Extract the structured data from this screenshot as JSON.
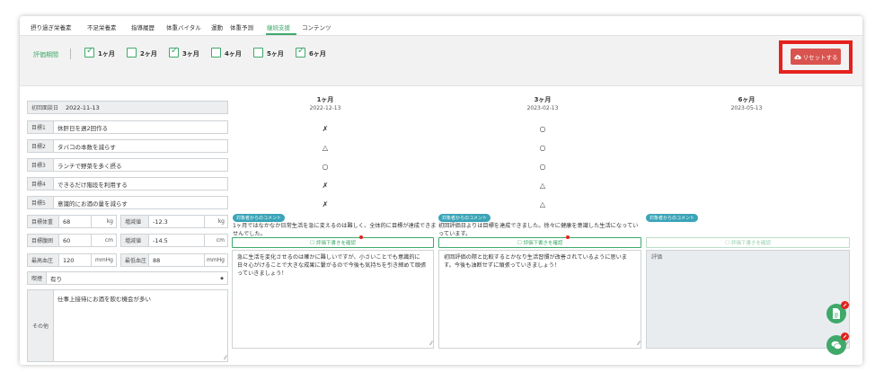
{
  "tabs": [
    {
      "label": "摂り過ぎ栄養素"
    },
    {
      "label": "不足栄養素"
    },
    {
      "label": "指導履歴"
    },
    {
      "label": "体重バイタル"
    },
    {
      "label": "運動"
    },
    {
      "label": "体重予測"
    },
    {
      "label": "継続支援"
    },
    {
      "label": "コンテンツ"
    }
  ],
  "filter": {
    "label": "評価期間",
    "options": [
      {
        "label": "1ヶ月",
        "checked": true
      },
      {
        "label": "2ヶ月",
        "checked": false
      },
      {
        "label": "3ヶ月",
        "checked": true
      },
      {
        "label": "4ヶ月",
        "checked": false
      },
      {
        "label": "5ヶ月",
        "checked": false
      },
      {
        "label": "6ヶ月",
        "checked": true
      }
    ],
    "reset_label": "リセットする"
  },
  "left": {
    "first_interview_label": "初回面談日",
    "first_interview_value": "2022-11-13",
    "goals": [
      {
        "label": "目標1",
        "value": "休肝日を週2回作る"
      },
      {
        "label": "目標2",
        "value": "タバコの本数を減らす"
      },
      {
        "label": "目標3",
        "value": "ランチで野菜を多く摂る"
      },
      {
        "label": "目標4",
        "value": "できるだけ階段を利用する"
      },
      {
        "label": "目標5",
        "value": "意識的にお酒の量を減らす"
      }
    ],
    "metrics": [
      {
        "label": "目標体重",
        "value": "68",
        "unit": "kg",
        "label2": "増減値",
        "value2": "-12.3",
        "unit2": "kg"
      },
      {
        "label": "目標腹囲",
        "value": "60",
        "unit": "cm",
        "label2": "増減値",
        "value2": "-14.5",
        "unit2": "cm"
      },
      {
        "label": "最高血圧",
        "value": "120",
        "unit": "mmHg",
        "label2": "最低血圧",
        "value2": "88",
        "unit2": "mmHg"
      }
    ],
    "smoking_label": "喫煙",
    "smoking_value": "有り",
    "other_label": "その他",
    "other_value": "仕事上接待にお酒を飲む機会が多い"
  },
  "columns": [
    {
      "month": "1ヶ月",
      "date": "2022-12-13",
      "marks": [
        "✗",
        "△",
        "○",
        "✗",
        "✗"
      ],
      "comment_tag": "対象者からのコメント",
      "comment": "1ヶ月ではなかなか日常生活を急に変えるのは難しく、全体的に目標が達成できませんでした。",
      "eval_button": "評価下書きを確認",
      "eval_text": "急に生活を変化させるのは確かに難しいですが、小さいことでも意識的に日々心がけることで大きな成果に繋がるので今後も気持ちを引き締めて頑張っていきましょう！"
    },
    {
      "month": "3ヶ月",
      "date": "2023-02-13",
      "marks": [
        "○",
        "○",
        "○",
        "△",
        "△"
      ],
      "comment_tag": "対象者からのコメント",
      "comment": "初回評価日よりは目標を達成できました。徐々に健康を意識した生活になっていっています。",
      "eval_button": "評価下書きを確認",
      "eval_text": "初回評価の際と比較するとかなり生活習慣が改善されているように思います。今後も油断せずに頑張っていきましょう！"
    },
    {
      "month": "6ヶ月",
      "date": "2023-05-13",
      "marks": [
        "",
        "",
        "",
        "",
        ""
      ],
      "comment_tag": "対象者からのコメント",
      "comment": "",
      "eval_button": "評価下書きを確認",
      "eval_text": "評価"
    }
  ],
  "icons": {
    "reset": "cloud-upload-icon",
    "fab1": "document-icon",
    "fab2": "chat-icon",
    "badge": "pencil-icon"
  },
  "colors": {
    "accent": "#3fa96a",
    "danger": "#d9534f",
    "highlight": "#e5211d",
    "tag": "#3aa4b8"
  }
}
